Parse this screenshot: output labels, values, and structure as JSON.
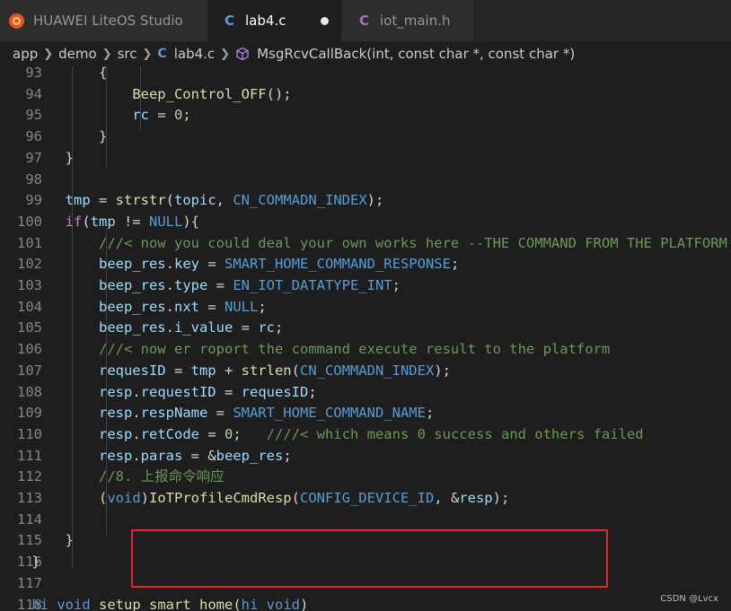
{
  "tabs": [
    {
      "label": "HUAWEI LiteOS Studio"
    },
    {
      "label": "lab4.c",
      "icon": "C",
      "modified": true
    },
    {
      "label": "iot_main.h",
      "icon": "C"
    }
  ],
  "breadcrumb": {
    "items": [
      "app",
      "demo",
      "src",
      "lab4.c",
      "MsgRcvCallBack(int, const char *, const char *)"
    ],
    "file_icon": "C"
  },
  "editor": {
    "line_numbers": [
      "93",
      "94",
      "95",
      "96",
      "97",
      "98",
      "99",
      "100",
      "101",
      "102",
      "103",
      "104",
      "105",
      "106",
      "107",
      "108",
      "109",
      "110",
      "111",
      "112",
      "113",
      "114",
      "115",
      "116",
      "117",
      "118"
    ],
    "lines": [
      [
        {
          "t": "            {",
          "c": "pun"
        }
      ],
      [
        {
          "t": "                ",
          "c": "pun"
        },
        {
          "t": "Beep_Control_OFF",
          "c": "fn"
        },
        {
          "t": "();",
          "c": "pun"
        }
      ],
      [
        {
          "t": "                ",
          "c": "pun"
        },
        {
          "t": "rc",
          "c": "var"
        },
        {
          "t": " = ",
          "c": "pun"
        },
        {
          "t": "0",
          "c": "num"
        },
        {
          "t": ";",
          "c": "pun"
        }
      ],
      [
        {
          "t": "            }",
          "c": "pun"
        }
      ],
      [
        {
          "t": "        }",
          "c": "pun"
        }
      ],
      [],
      [
        {
          "t": "        ",
          "c": "pun"
        },
        {
          "t": "tmp",
          "c": "var"
        },
        {
          "t": " = ",
          "c": "pun"
        },
        {
          "t": "strstr",
          "c": "fn"
        },
        {
          "t": "(",
          "c": "pun"
        },
        {
          "t": "topic",
          "c": "var"
        },
        {
          "t": ", ",
          "c": "pun"
        },
        {
          "t": "CN_COMMADN_INDEX",
          "c": "mac"
        },
        {
          "t": ");",
          "c": "pun"
        }
      ],
      [
        {
          "t": "        ",
          "c": "pun"
        },
        {
          "t": "if",
          "c": "ctl"
        },
        {
          "t": "(",
          "c": "pun"
        },
        {
          "t": "tmp",
          "c": "var"
        },
        {
          "t": " != ",
          "c": "pun"
        },
        {
          "t": "NULL",
          "c": "mac"
        },
        {
          "t": "){",
          "c": "pun"
        }
      ],
      [
        {
          "t": "            ",
          "c": "pun"
        },
        {
          "t": "///< now you could deal your own works here --THE COMMAND FROM THE PLATFORM",
          "c": "cm"
        }
      ],
      [
        {
          "t": "            ",
          "c": "pun"
        },
        {
          "t": "beep_res",
          "c": "var"
        },
        {
          "t": ".",
          "c": "pun"
        },
        {
          "t": "key",
          "c": "var"
        },
        {
          "t": " = ",
          "c": "pun"
        },
        {
          "t": "SMART_HOME_COMMAND_RESPONSE",
          "c": "mac"
        },
        {
          "t": ";",
          "c": "pun"
        }
      ],
      [
        {
          "t": "            ",
          "c": "pun"
        },
        {
          "t": "beep_res",
          "c": "var"
        },
        {
          "t": ".",
          "c": "pun"
        },
        {
          "t": "type",
          "c": "var"
        },
        {
          "t": " = ",
          "c": "pun"
        },
        {
          "t": "EN_IOT_DATATYPE_INT",
          "c": "mac"
        },
        {
          "t": ";",
          "c": "pun"
        }
      ],
      [
        {
          "t": "            ",
          "c": "pun"
        },
        {
          "t": "beep_res",
          "c": "var"
        },
        {
          "t": ".",
          "c": "pun"
        },
        {
          "t": "nxt",
          "c": "var"
        },
        {
          "t": " = ",
          "c": "pun"
        },
        {
          "t": "NULL",
          "c": "mac"
        },
        {
          "t": ";",
          "c": "pun"
        }
      ],
      [
        {
          "t": "            ",
          "c": "pun"
        },
        {
          "t": "beep_res",
          "c": "var"
        },
        {
          "t": ".",
          "c": "pun"
        },
        {
          "t": "i_value",
          "c": "var"
        },
        {
          "t": " = ",
          "c": "pun"
        },
        {
          "t": "rc",
          "c": "var"
        },
        {
          "t": ";",
          "c": "pun"
        }
      ],
      [
        {
          "t": "            ",
          "c": "pun"
        },
        {
          "t": "///< now er roport the command execute result to the platform",
          "c": "cm"
        }
      ],
      [
        {
          "t": "            ",
          "c": "pun"
        },
        {
          "t": "requesID",
          "c": "var"
        },
        {
          "t": " = ",
          "c": "pun"
        },
        {
          "t": "tmp",
          "c": "var"
        },
        {
          "t": " + ",
          "c": "pun"
        },
        {
          "t": "strlen",
          "c": "fn"
        },
        {
          "t": "(",
          "c": "pun"
        },
        {
          "t": "CN_COMMADN_INDEX",
          "c": "mac"
        },
        {
          "t": ");",
          "c": "pun"
        }
      ],
      [
        {
          "t": "            ",
          "c": "pun"
        },
        {
          "t": "resp",
          "c": "var"
        },
        {
          "t": ".",
          "c": "pun"
        },
        {
          "t": "requestID",
          "c": "var"
        },
        {
          "t": " = ",
          "c": "pun"
        },
        {
          "t": "requesID",
          "c": "var"
        },
        {
          "t": ";",
          "c": "pun"
        }
      ],
      [
        {
          "t": "            ",
          "c": "pun"
        },
        {
          "t": "resp",
          "c": "var"
        },
        {
          "t": ".",
          "c": "pun"
        },
        {
          "t": "respName",
          "c": "var"
        },
        {
          "t": " = ",
          "c": "pun"
        },
        {
          "t": "SMART_HOME_COMMAND_NAME",
          "c": "mac"
        },
        {
          "t": ";",
          "c": "pun"
        }
      ],
      [
        {
          "t": "            ",
          "c": "pun"
        },
        {
          "t": "resp",
          "c": "var"
        },
        {
          "t": ".",
          "c": "pun"
        },
        {
          "t": "retCode",
          "c": "var"
        },
        {
          "t": " = ",
          "c": "pun"
        },
        {
          "t": "0",
          "c": "num"
        },
        {
          "t": ";   ",
          "c": "pun"
        },
        {
          "t": "////< which means 0 success and others failed",
          "c": "cm"
        }
      ],
      [
        {
          "t": "            ",
          "c": "pun"
        },
        {
          "t": "resp",
          "c": "var"
        },
        {
          "t": ".",
          "c": "pun"
        },
        {
          "t": "paras",
          "c": "var"
        },
        {
          "t": " = &",
          "c": "pun"
        },
        {
          "t": "beep_res",
          "c": "var"
        },
        {
          "t": ";",
          "c": "pun"
        }
      ],
      [
        {
          "t": "            ",
          "c": "pun"
        },
        {
          "t": "//8. 上报命令响应",
          "c": "cm"
        }
      ],
      [
        {
          "t": "            (",
          "c": "pun"
        },
        {
          "t": "void",
          "c": "kw"
        },
        {
          "t": ")",
          "c": "pun"
        },
        {
          "t": "IoTProfileCmdResp",
          "c": "fn"
        },
        {
          "t": "(",
          "c": "pun"
        },
        {
          "t": "CONFIG_DEVICE_ID",
          "c": "mac"
        },
        {
          "t": ", &",
          "c": "pun"
        },
        {
          "t": "resp",
          "c": "var"
        },
        {
          "t": ");",
          "c": "pun"
        }
      ],
      [],
      [
        {
          "t": "        }",
          "c": "pun"
        }
      ],
      [
        {
          "t": "    }",
          "c": "pun"
        }
      ],
      [],
      [
        {
          "t": "    ",
          "c": "pun"
        },
        {
          "t": "hi_void",
          "c": "kw"
        },
        {
          "t": " ",
          "c": "pun"
        },
        {
          "t": "setup_smart_home",
          "c": "fn"
        },
        {
          "t": "(",
          "c": "pun"
        },
        {
          "t": "hi_void",
          "c": "kw"
        },
        {
          "t": ")",
          "c": "pun"
        }
      ]
    ]
  },
  "watermark": "CSDN @Lvcx",
  "colors": {
    "highlight_box": "#e8262b",
    "editor_bg": "#1e1e1e"
  }
}
